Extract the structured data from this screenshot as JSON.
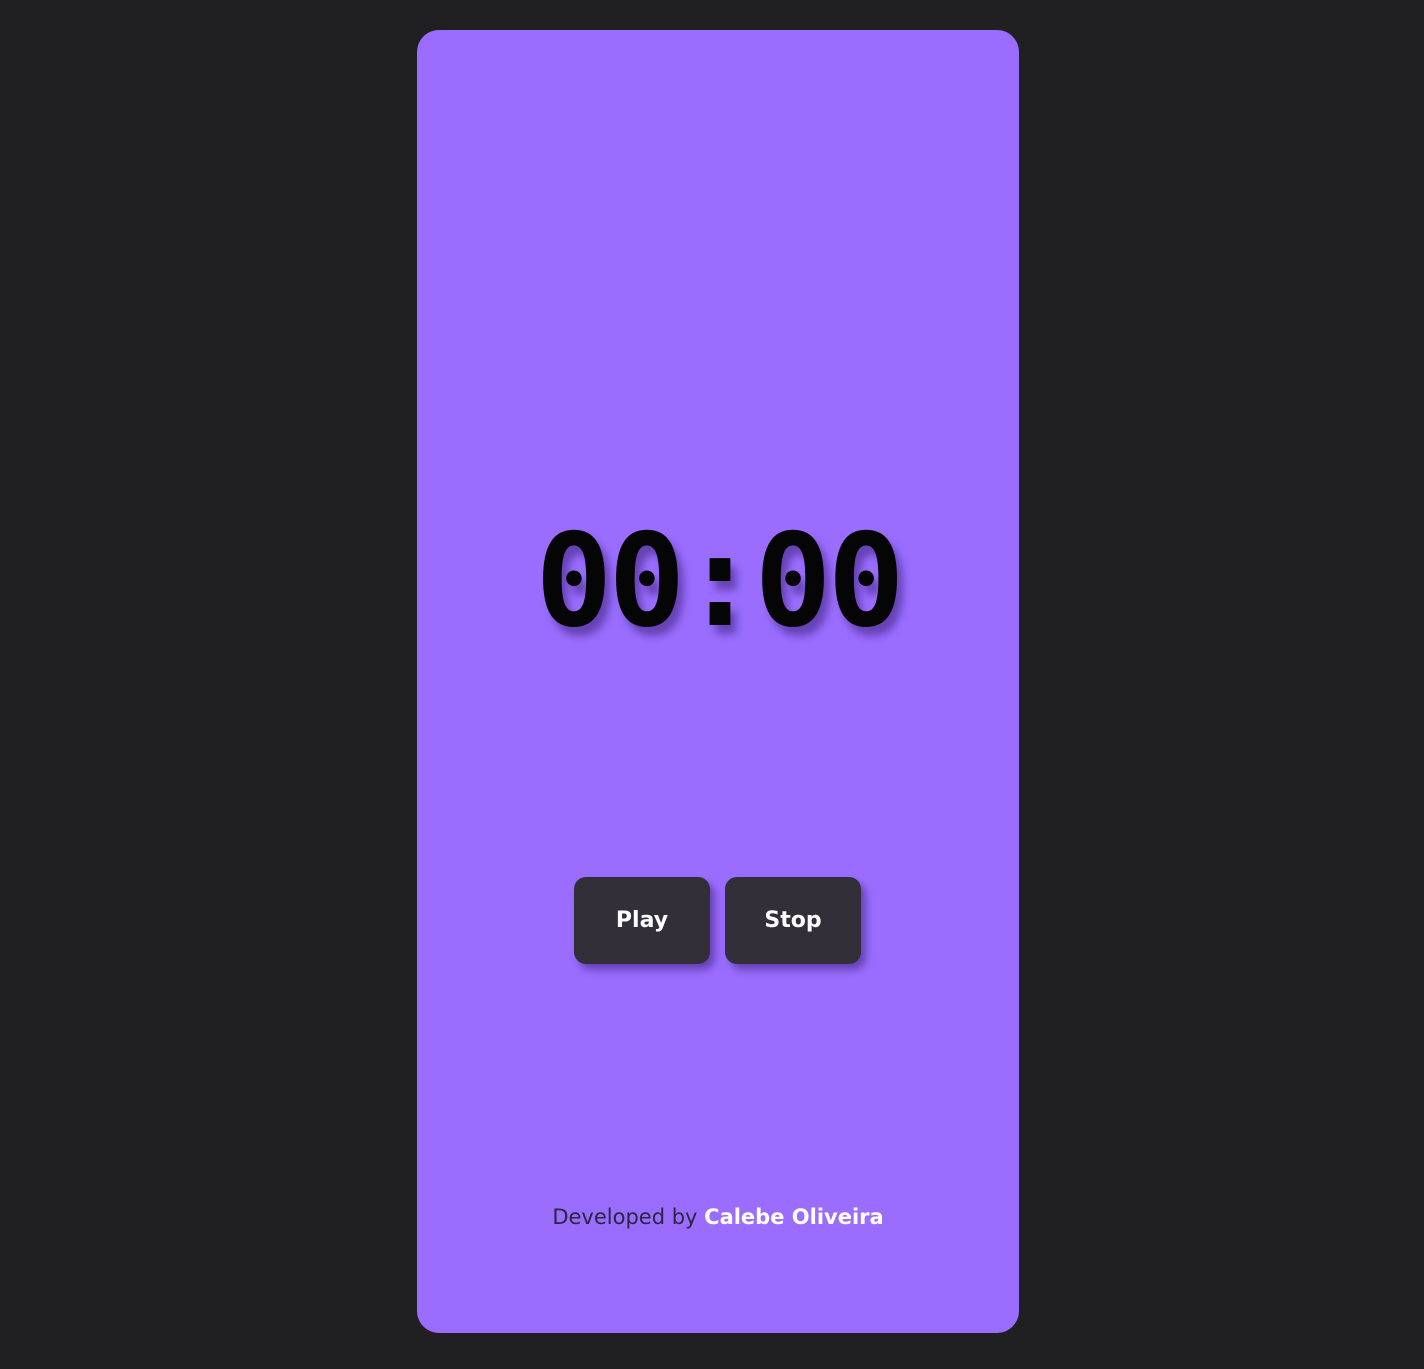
{
  "timer": {
    "display": "00:00"
  },
  "controls": {
    "play_label": "Play",
    "stop_label": "Stop"
  },
  "footer": {
    "prefix": "Developed by",
    "author": "Calebe Oliveira"
  },
  "colors": {
    "page_background": "#202022",
    "card_background": "#9a6dff",
    "button_background": "#322f39",
    "timer_text": "#050505"
  }
}
